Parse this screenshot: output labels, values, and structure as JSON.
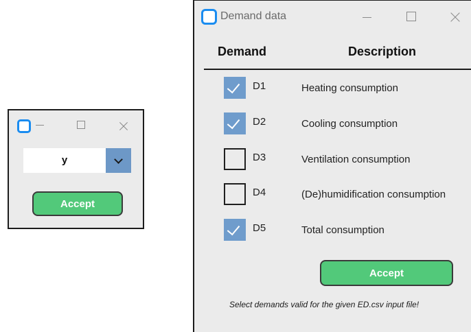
{
  "small_window": {
    "title": "",
    "combo_value": "y",
    "accept_label": "Accept"
  },
  "demand_window": {
    "title": "Demand data",
    "headers": {
      "demand": "Demand",
      "description": "Description"
    },
    "rows": [
      {
        "code": "D1",
        "description": "Heating consumption",
        "checked": true
      },
      {
        "code": "D2",
        "description": "Cooling consumption",
        "checked": true
      },
      {
        "code": "D3",
        "description": "Ventilation consumption",
        "checked": false
      },
      {
        "code": "D4",
        "description": "(De)humidification consumption",
        "checked": false
      },
      {
        "code": "D5",
        "description": "Total consumption",
        "checked": true
      }
    ],
    "accept_label": "Accept",
    "note": "Select demands valid for the given ED.csv input file!"
  },
  "colors": {
    "accent_blue": "#1a8cf0",
    "checkbox_checked": "#6f9ccc",
    "accept_green": "#52c97a",
    "window_bg": "#ebebeb"
  },
  "icons": {
    "app": "app-icon",
    "minimize": "minimize-icon",
    "maximize": "maximize-icon",
    "close": "close-icon",
    "dropdown": "chevron-down-icon",
    "check": "checkmark-icon"
  }
}
